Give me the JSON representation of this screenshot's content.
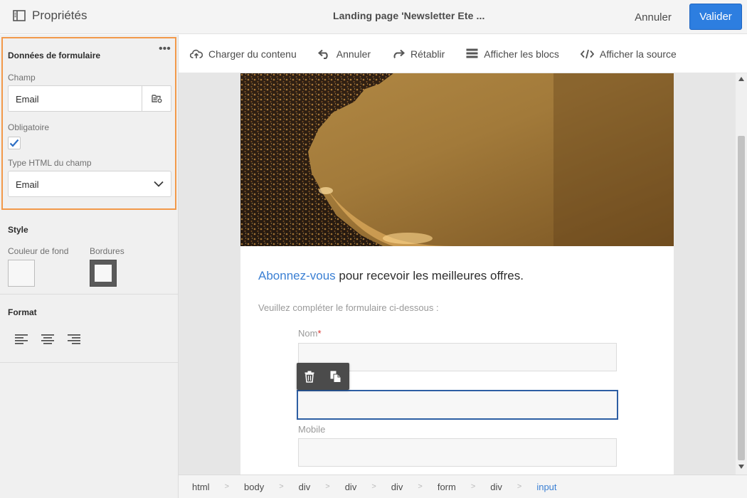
{
  "header": {
    "panel_title": "Propriétés",
    "document_title": "Landing page 'Newsletter Ete ...",
    "cancel_label": "Annuler",
    "validate_label": "Valider",
    "accent_color": "#2d7ee0"
  },
  "form_data_section": {
    "title": "Données de formulaire",
    "field_label": "Champ",
    "field_value": "Email",
    "required_label": "Obligatoire",
    "required_checked": true,
    "html_type_label": "Type HTML du champ",
    "html_type_value": "Email",
    "highlight_color": "#f2994a"
  },
  "style_section": {
    "title": "Style",
    "bg_color_label": "Couleur de fond",
    "border_label": "Bordures"
  },
  "format_section": {
    "title": "Format"
  },
  "toolbar": {
    "items": [
      {
        "label": "Charger du contenu",
        "icon": "cloud-upload-icon"
      },
      {
        "label": "Annuler",
        "icon": "undo-icon"
      },
      {
        "label": "Rétablir",
        "icon": "redo-icon"
      },
      {
        "label": "Afficher les blocs",
        "icon": "blocks-icon"
      },
      {
        "label": "Afficher la source",
        "icon": "code-icon"
      }
    ]
  },
  "email": {
    "headline_link": "Abonnez-vous",
    "headline_rest": " pour recevoir les meilleures offres.",
    "subline": "Veuillez compléter le formulaire ci-dessous :",
    "fields": [
      {
        "label": "Nom",
        "required": "*"
      },
      {
        "label": "Mobile"
      }
    ]
  },
  "breadcrumb": [
    "html",
    "body",
    "div",
    "div",
    "div",
    "form",
    "div",
    "input"
  ]
}
